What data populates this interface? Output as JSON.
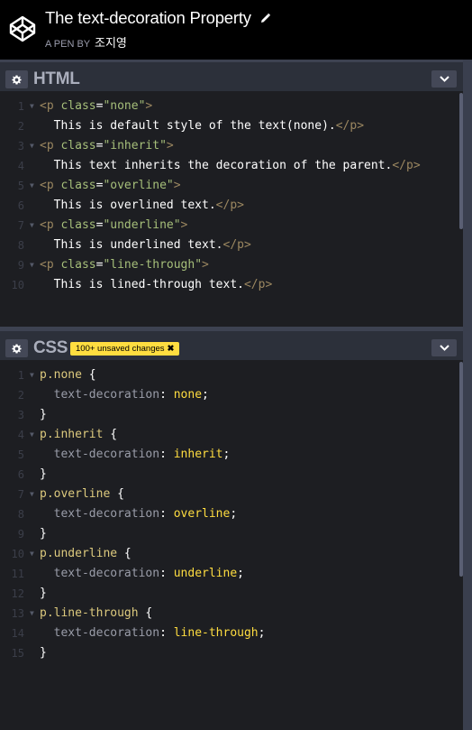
{
  "header": {
    "title": "The text-decoration Property",
    "by_label": "A PEN BY",
    "author": "조지영"
  },
  "html_panel": {
    "title": "HTML",
    "lines": [
      {
        "n": "1",
        "parts": [
          [
            "tag",
            "<p "
          ],
          [
            "attr",
            "class"
          ],
          [
            "plain",
            "="
          ],
          [
            "str",
            "\"none\""
          ],
          [
            "tag",
            ">"
          ]
        ]
      },
      {
        "n": "2",
        "parts": [
          [
            "plain",
            "  This is default style of the text(none)."
          ],
          [
            "tag",
            "</p>"
          ]
        ]
      },
      {
        "n": "3",
        "parts": [
          [
            "tag",
            "<p "
          ],
          [
            "attr",
            "class"
          ],
          [
            "plain",
            "="
          ],
          [
            "str",
            "\"inherit\""
          ],
          [
            "tag",
            ">"
          ]
        ]
      },
      {
        "n": "4",
        "parts": [
          [
            "plain",
            "  This text inherits the decoration of the parent."
          ],
          [
            "tag",
            "</p>"
          ]
        ]
      },
      {
        "n": "5",
        "parts": [
          [
            "tag",
            "<p "
          ],
          [
            "attr",
            "class"
          ],
          [
            "plain",
            "="
          ],
          [
            "str",
            "\"overline\""
          ],
          [
            "tag",
            ">"
          ]
        ]
      },
      {
        "n": "6",
        "parts": [
          [
            "plain",
            "  This is overlined text."
          ],
          [
            "tag",
            "</p>"
          ]
        ]
      },
      {
        "n": "7",
        "parts": [
          [
            "tag",
            "<p "
          ],
          [
            "attr",
            "class"
          ],
          [
            "plain",
            "="
          ],
          [
            "str",
            "\"underline\""
          ],
          [
            "tag",
            ">"
          ]
        ]
      },
      {
        "n": "8",
        "parts": [
          [
            "plain",
            "  This is underlined text."
          ],
          [
            "tag",
            "</p>"
          ]
        ]
      },
      {
        "n": "9",
        "parts": [
          [
            "tag",
            "<p "
          ],
          [
            "attr",
            "class"
          ],
          [
            "plain",
            "="
          ],
          [
            "str",
            "\"line-through\""
          ],
          [
            "tag",
            ">"
          ]
        ]
      },
      {
        "n": "10",
        "parts": [
          [
            "plain",
            "  This is lined-through text."
          ],
          [
            "tag",
            "</p>"
          ]
        ]
      }
    ],
    "folds": [
      1,
      3,
      5,
      7,
      9
    ]
  },
  "css_panel": {
    "title": "CSS",
    "badge": "100+ unsaved changes",
    "lines": [
      {
        "n": "1",
        "parts": [
          [
            "sel",
            "p.none"
          ],
          [
            "brace",
            " {"
          ]
        ]
      },
      {
        "n": "2",
        "parts": [
          [
            "prop",
            "  text-decoration"
          ],
          [
            "plain",
            ": "
          ],
          [
            "val",
            "none"
          ],
          [
            "plain",
            ";"
          ]
        ]
      },
      {
        "n": "3",
        "parts": [
          [
            "brace",
            "}"
          ]
        ]
      },
      {
        "n": "4",
        "parts": [
          [
            "sel",
            "p.inherit"
          ],
          [
            "brace",
            " {"
          ]
        ]
      },
      {
        "n": "5",
        "parts": [
          [
            "prop",
            "  text-decoration"
          ],
          [
            "plain",
            ": "
          ],
          [
            "val",
            "inherit"
          ],
          [
            "plain",
            ";"
          ]
        ]
      },
      {
        "n": "6",
        "parts": [
          [
            "brace",
            "}"
          ]
        ]
      },
      {
        "n": "7",
        "parts": [
          [
            "sel",
            "p.overline"
          ],
          [
            "brace",
            " {"
          ]
        ]
      },
      {
        "n": "8",
        "parts": [
          [
            "prop",
            "  text-decoration"
          ],
          [
            "plain",
            ": "
          ],
          [
            "val",
            "overline"
          ],
          [
            "plain",
            ";"
          ]
        ]
      },
      {
        "n": "9",
        "parts": [
          [
            "brace",
            "}"
          ]
        ]
      },
      {
        "n": "10",
        "parts": [
          [
            "sel",
            "p.underline"
          ],
          [
            "brace",
            " {"
          ]
        ]
      },
      {
        "n": "11",
        "parts": [
          [
            "prop",
            "  text-decoration"
          ],
          [
            "plain",
            ": "
          ],
          [
            "val",
            "underline"
          ],
          [
            "plain",
            ";"
          ]
        ]
      },
      {
        "n": "12",
        "parts": [
          [
            "brace",
            "}"
          ]
        ]
      },
      {
        "n": "13",
        "parts": [
          [
            "sel",
            "p.line-through"
          ],
          [
            "brace",
            " {"
          ]
        ]
      },
      {
        "n": "14",
        "parts": [
          [
            "prop",
            "  text-decoration"
          ],
          [
            "plain",
            ": "
          ],
          [
            "val",
            "line-through"
          ],
          [
            "plain",
            ";"
          ]
        ]
      },
      {
        "n": "15",
        "parts": [
          [
            "brace",
            "}"
          ]
        ]
      }
    ],
    "folds": [
      1,
      4,
      7,
      10,
      13
    ]
  },
  "icons": {
    "logo": "codepen-logo-icon",
    "edit": "pencil-icon",
    "settings": "gear-icon",
    "collapse": "chevron-down-icon",
    "dismiss": "close-icon"
  },
  "colors": {
    "badge": "#ffdd40",
    "selector": "#ddca7e",
    "value": "#ffdd40",
    "attribute": "#a6bf7a",
    "tag": "#9b8760"
  }
}
